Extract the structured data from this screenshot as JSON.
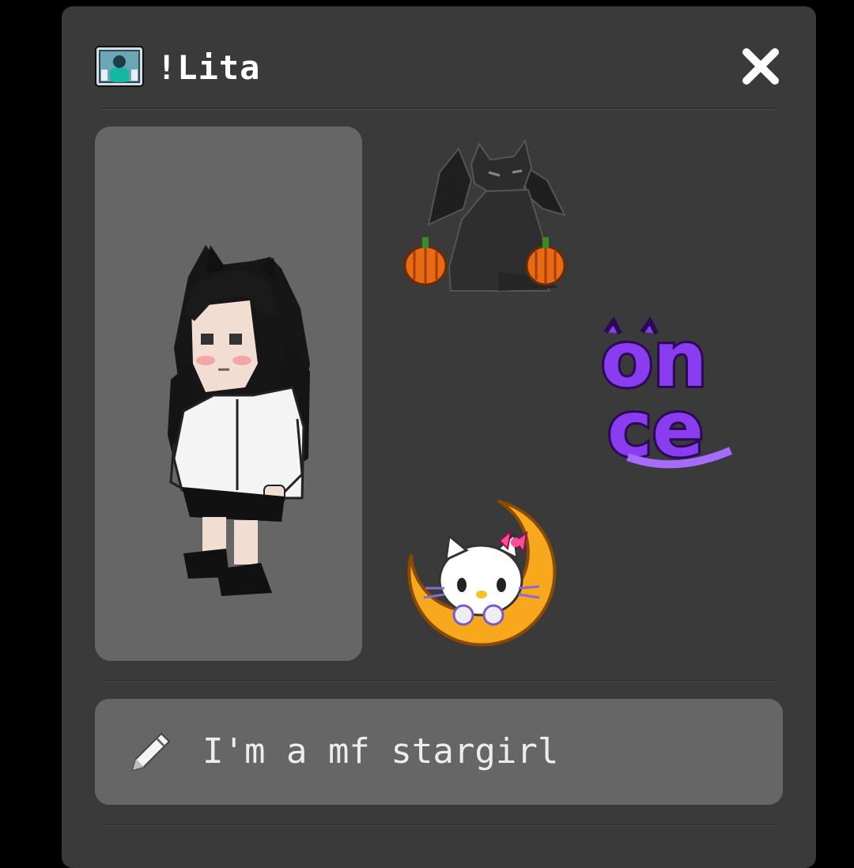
{
  "profile": {
    "username": "!Lita",
    "motto": "I'm a mf stargirl"
  },
  "badges": [
    {
      "name": "bat-winged-cat-pumpkins-badge"
    },
    {
      "name": "once-badge",
      "text": "once"
    },
    {
      "name": "hello-kitty-moon-badge"
    }
  ],
  "colors": {
    "panel": "#3a3a3a",
    "card": "#666666",
    "text": "#ffffff",
    "badge_purple": "#8a3cf0",
    "moon": "#f5a21c"
  },
  "icons": {
    "header": "user-avatar-icon",
    "close": "close-icon",
    "motto": "pencil-icon"
  }
}
